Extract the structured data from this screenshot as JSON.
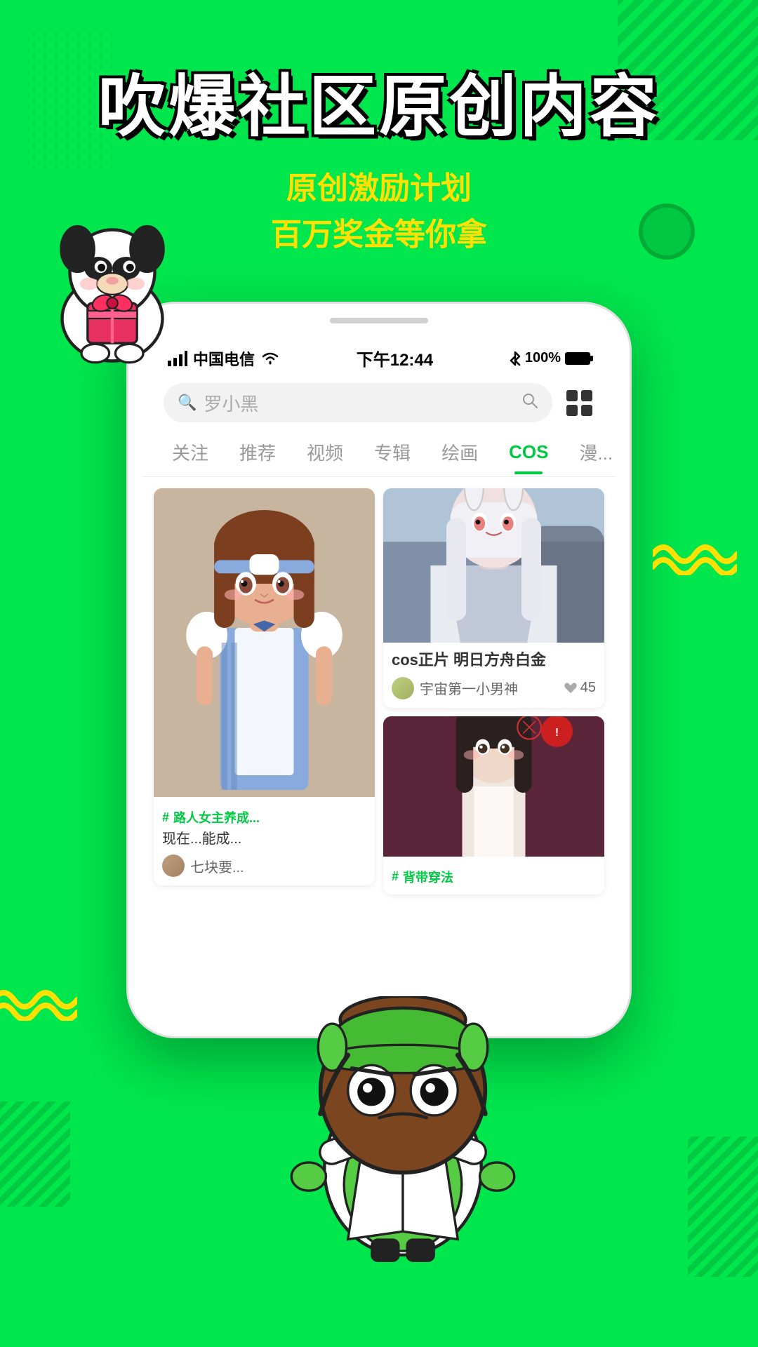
{
  "background": {
    "color": "#00e64d"
  },
  "title_area": {
    "main_title": "吹爆社区原创内容",
    "subtitle_line1": "原创激励计划",
    "subtitle_line2": "百万奖金等你拿"
  },
  "status_bar": {
    "carrier": "中国电信",
    "wifi": "WiFi",
    "time": "下午12:44",
    "bluetooth": "蓝牙",
    "battery": "100%"
  },
  "search": {
    "placeholder": "罗小黑"
  },
  "tabs": [
    {
      "label": "关注",
      "active": false
    },
    {
      "label": "推荐",
      "active": false
    },
    {
      "label": "视频",
      "active": false
    },
    {
      "label": "专辑",
      "active": false
    },
    {
      "label": "绘画",
      "active": false
    },
    {
      "label": "COS",
      "active": true
    },
    {
      "label": "漫...",
      "active": false
    }
  ],
  "content": {
    "left_col": [
      {
        "type": "tall_image",
        "tag": "路人女主养成...",
        "desc": "现在...能成...",
        "username": "七块要...",
        "likes": ""
      }
    ],
    "right_col": [
      {
        "type": "short_image",
        "title": "cos正片 明日方舟白金",
        "username": "宇宙第一小男神",
        "likes": "45"
      },
      {
        "type": "short_image",
        "title": "",
        "username": "",
        "tag": "背带穿法",
        "likes": ""
      }
    ]
  },
  "waves": {
    "color": "#FFE000"
  }
}
